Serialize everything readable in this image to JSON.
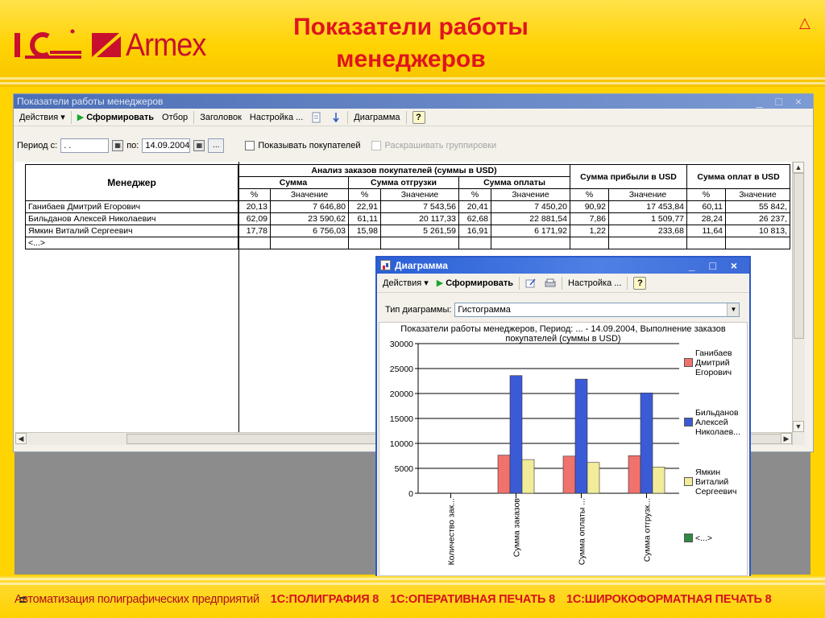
{
  "slide": {
    "title_line1": "Показатели работы",
    "title_line2": "менеджеров",
    "logo_1c": "1С",
    "logo_armex": "Armex",
    "nav_triangle": "△"
  },
  "footer": {
    "prefix": "Автоматизация полиграфических предприятий",
    "products": [
      "1С:ПОЛИГРАФИЯ 8",
      "1С:ОПЕРАТИВНАЯ ПЕЧАТЬ 8",
      "1С:ШИРОКОФОРМАТНАЯ ПЕЧАТЬ 8"
    ]
  },
  "main_window": {
    "title": "Показатели работы менеджеров",
    "controls": "_ □ ×",
    "toolbar": {
      "actions": "Действия ▾",
      "form": "Сформировать",
      "filter": "Отбор",
      "header": "Заголовок",
      "settings": "Настройка ...",
      "diagram": "Диаграмма",
      "help": "?"
    },
    "period": {
      "from_label": "Период с:",
      "from_value": " .  .",
      "to_label": "по:",
      "to_value": "14.09.2004",
      "dots": "...",
      "show_buyers": "Показывать покупателей",
      "color_groups": "Раскрашивать группировки"
    }
  },
  "report": {
    "col_manager": "Менеджер",
    "group_orders": "Анализ заказов покупателей (суммы в USD)",
    "group_sum": "Сумма",
    "group_shipment": "Сумма отгрузки",
    "group_payment": "Сумма оплаты",
    "group_profit": "Сумма прибыли в USD",
    "group_paid": "Сумма оплат в USD",
    "pct": "%",
    "value": "Значение",
    "rows": [
      {
        "name": "Ганибаев Дмитрий Егорович",
        "v": [
          "20,13",
          "7 646,80",
          "22,91",
          "7 543,56",
          "20,41",
          "7 450,20",
          "90,92",
          "17 453,84",
          "60,11",
          "55 842,"
        ]
      },
      {
        "name": "Бильданов Алексей Николаевич",
        "v": [
          "62,09",
          "23 590,62",
          "61,11",
          "20 117,33",
          "62,68",
          "22 881,54",
          "7,86",
          "1 509,77",
          "28,24",
          "26 237,"
        ]
      },
      {
        "name": "Ямкин Виталий Сергеевич",
        "v": [
          "17,78",
          "6 756,03",
          "15,98",
          "5 261,59",
          "16,91",
          "6 171,92",
          "1,22",
          "233,68",
          "11,64",
          "10 813,"
        ]
      },
      {
        "name": "<...>",
        "v": [
          "",
          "",
          "",
          "",
          "",
          "",
          "",
          "",
          "",
          ""
        ]
      }
    ]
  },
  "diagram_window": {
    "title": "Диаграмма",
    "controls": "_ □ ×",
    "toolbar": {
      "actions": "Действия ▾",
      "form": "Сформировать",
      "settings": "Настройка ...",
      "help": "?"
    },
    "type_label": "Тип диаграммы:",
    "type_value": "Гистограмма"
  },
  "chart_data": {
    "type": "bar",
    "title": "Показатели работы менеджеров, Период: ... - 14.09.2004, Выполнение заказов покупателей (суммы в USD)",
    "categories": [
      "Количество зак...",
      "Сумма заказов",
      "Сумма оплаты ...",
      "Сумма отгрузк..."
    ],
    "yticks": [
      "30000",
      "25000",
      "20000",
      "15000",
      "10000",
      "5000",
      "0"
    ],
    "ylim": [
      0,
      30000
    ],
    "grid": true,
    "legend_position": "right",
    "series": [
      {
        "name": "Ганибаев Дмитрий Егорович",
        "legend_lines": [
          "Ганибаев",
          "Дмитрий",
          "Егорович"
        ],
        "color": "#f0726d",
        "values": [
          0,
          7646.8,
          7450.2,
          7543.56
        ]
      },
      {
        "name": "Бильданов Алексей Николаев...",
        "legend_lines": [
          "Бильданов",
          "Алексей",
          "Николаев..."
        ],
        "color": "#3b5bd6",
        "values": [
          0,
          23590.62,
          22881.54,
          20117.33
        ]
      },
      {
        "name": "Ямкин Виталий Сергеевич",
        "legend_lines": [
          "Ямкин",
          "Виталий",
          "Сергеевич"
        ],
        "color": "#f2ec9a",
        "values": [
          0,
          6756.03,
          6171.92,
          5261.59
        ]
      },
      {
        "name": "<...>",
        "legend_lines": [
          "<...>"
        ],
        "color": "#2e8a43",
        "values": [
          0,
          0,
          0,
          0
        ]
      }
    ]
  }
}
